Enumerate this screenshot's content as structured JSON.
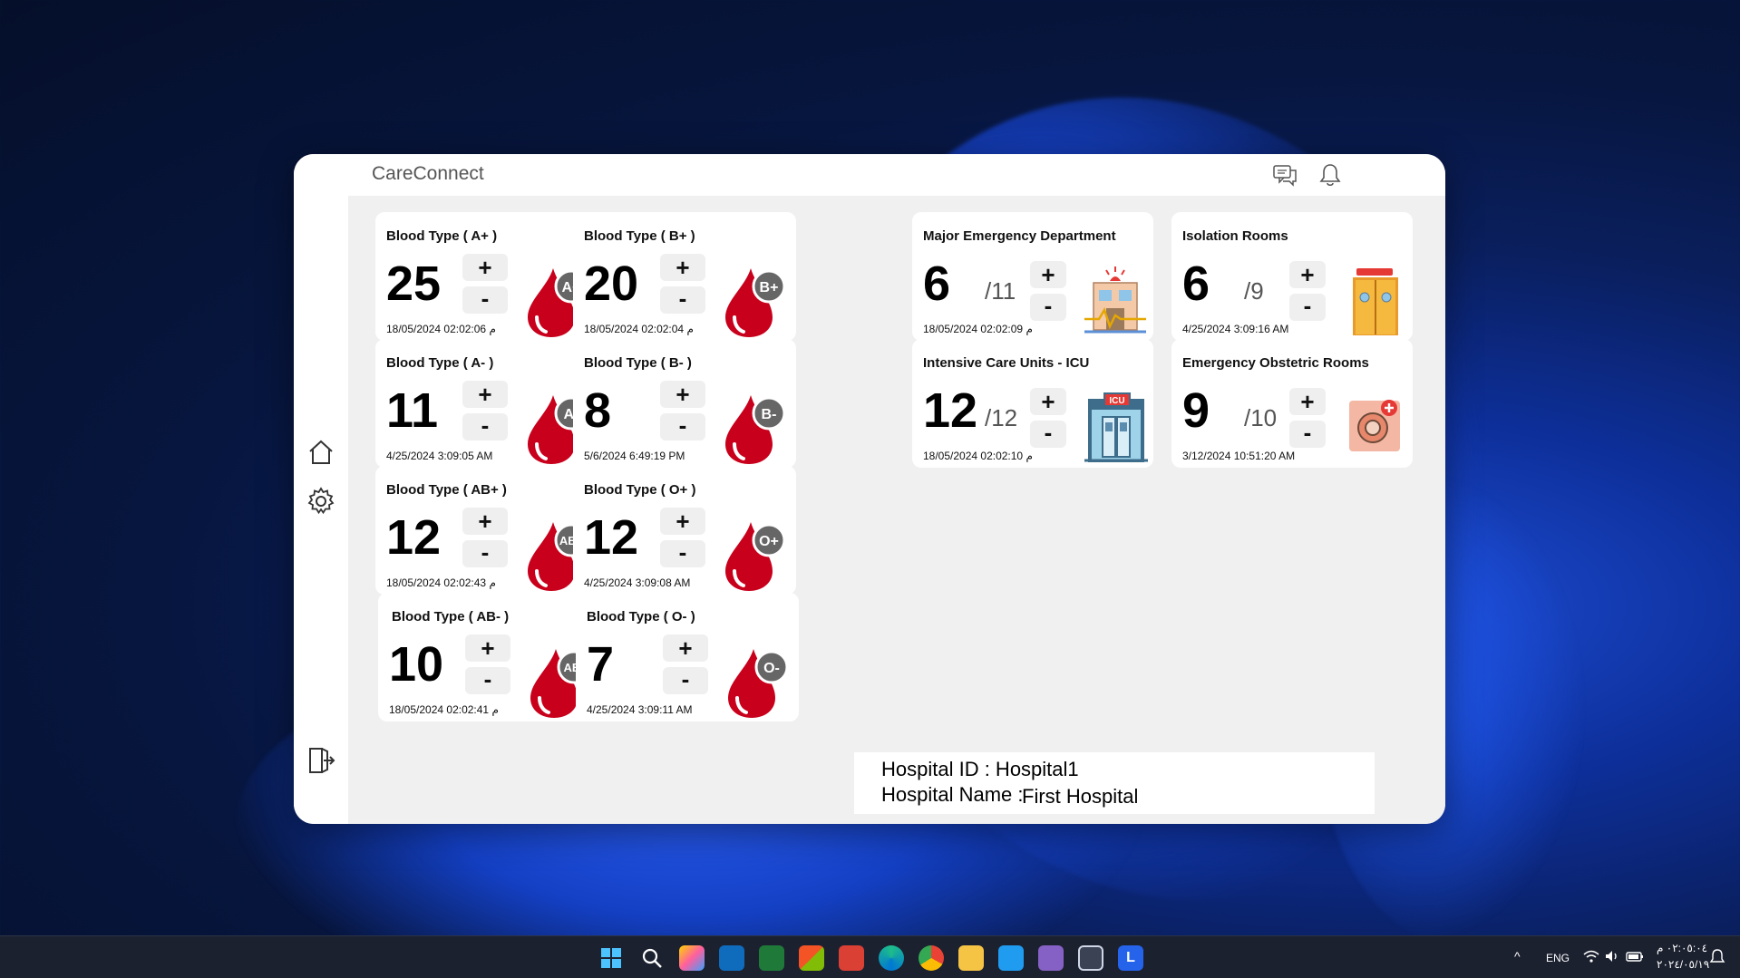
{
  "app": {
    "title": "CareConnect"
  },
  "blood_cards": [
    {
      "title": "Blood Type ( A+ )",
      "count": "25",
      "timestamp": "18/05/2024 02:02:06  م",
      "badge": "A+"
    },
    {
      "title": "Blood Type ( B+ )",
      "count": "20",
      "timestamp": "18/05/2024 02:02:04  م",
      "badge": "B+"
    },
    {
      "title": "Blood Type ( A- )",
      "count": "11",
      "timestamp": "4/25/2024 3:09:05 AM",
      "badge": "A-"
    },
    {
      "title": "Blood Type ( B- )",
      "count": "8",
      "timestamp": "5/6/2024 6:49:19 PM",
      "badge": "B-"
    },
    {
      "title": "Blood Type ( AB+ )",
      "count": "12",
      "timestamp": "18/05/2024 02:02:43  م",
      "badge": "AB+"
    },
    {
      "title": "Blood Type ( O+ )",
      "count": "12",
      "timestamp": "4/25/2024 3:09:08 AM",
      "badge": "O+"
    },
    {
      "title": "Blood Type ( AB- )",
      "count": "10",
      "timestamp": "18/05/2024 02:02:41  م",
      "badge": "AB-"
    },
    {
      "title": "Blood Type ( O- )",
      "count": "7",
      "timestamp": "4/25/2024 3:09:11 AM",
      "badge": "O-"
    }
  ],
  "room_cards": [
    {
      "title": "Major Emergency Department",
      "count": "6",
      "capacity": "/11",
      "timestamp": "18/05/2024 02:02:09 م",
      "icon": "emergency-building-icon"
    },
    {
      "title": "Isolation Rooms",
      "count": "6",
      "capacity": "/9",
      "timestamp": "4/25/2024 3:09:16 AM",
      "icon": "isolation-door-icon"
    },
    {
      "title": "Intensive Care Units - ICU",
      "count": "12",
      "capacity": "/12",
      "timestamp": "18/05/2024 02:02:10  م",
      "icon": "icu-door-icon",
      "icu_label": "ICU"
    },
    {
      "title": "Emergency Obstetric Rooms",
      "count": "9",
      "capacity": "/10",
      "timestamp": "3/12/2024 10:51:20 AM",
      "icon": "obstetric-icon"
    }
  ],
  "controls": {
    "plus": "+",
    "minus": "-"
  },
  "hospital": {
    "id_line": "Hospital ID : Hospital1",
    "name_label": "Hospital Name :",
    "name_value": "First Hospital"
  },
  "taskbar": {
    "lang": "ENG",
    "time": "٠٢:٠٥:٠٤ م",
    "date": "٢٠٢٤/٠٥/١٩",
    "app_l": "L"
  },
  "colors": {
    "blood": "#c8001b",
    "badge": "#666666",
    "panel": "#f0f0f0"
  }
}
